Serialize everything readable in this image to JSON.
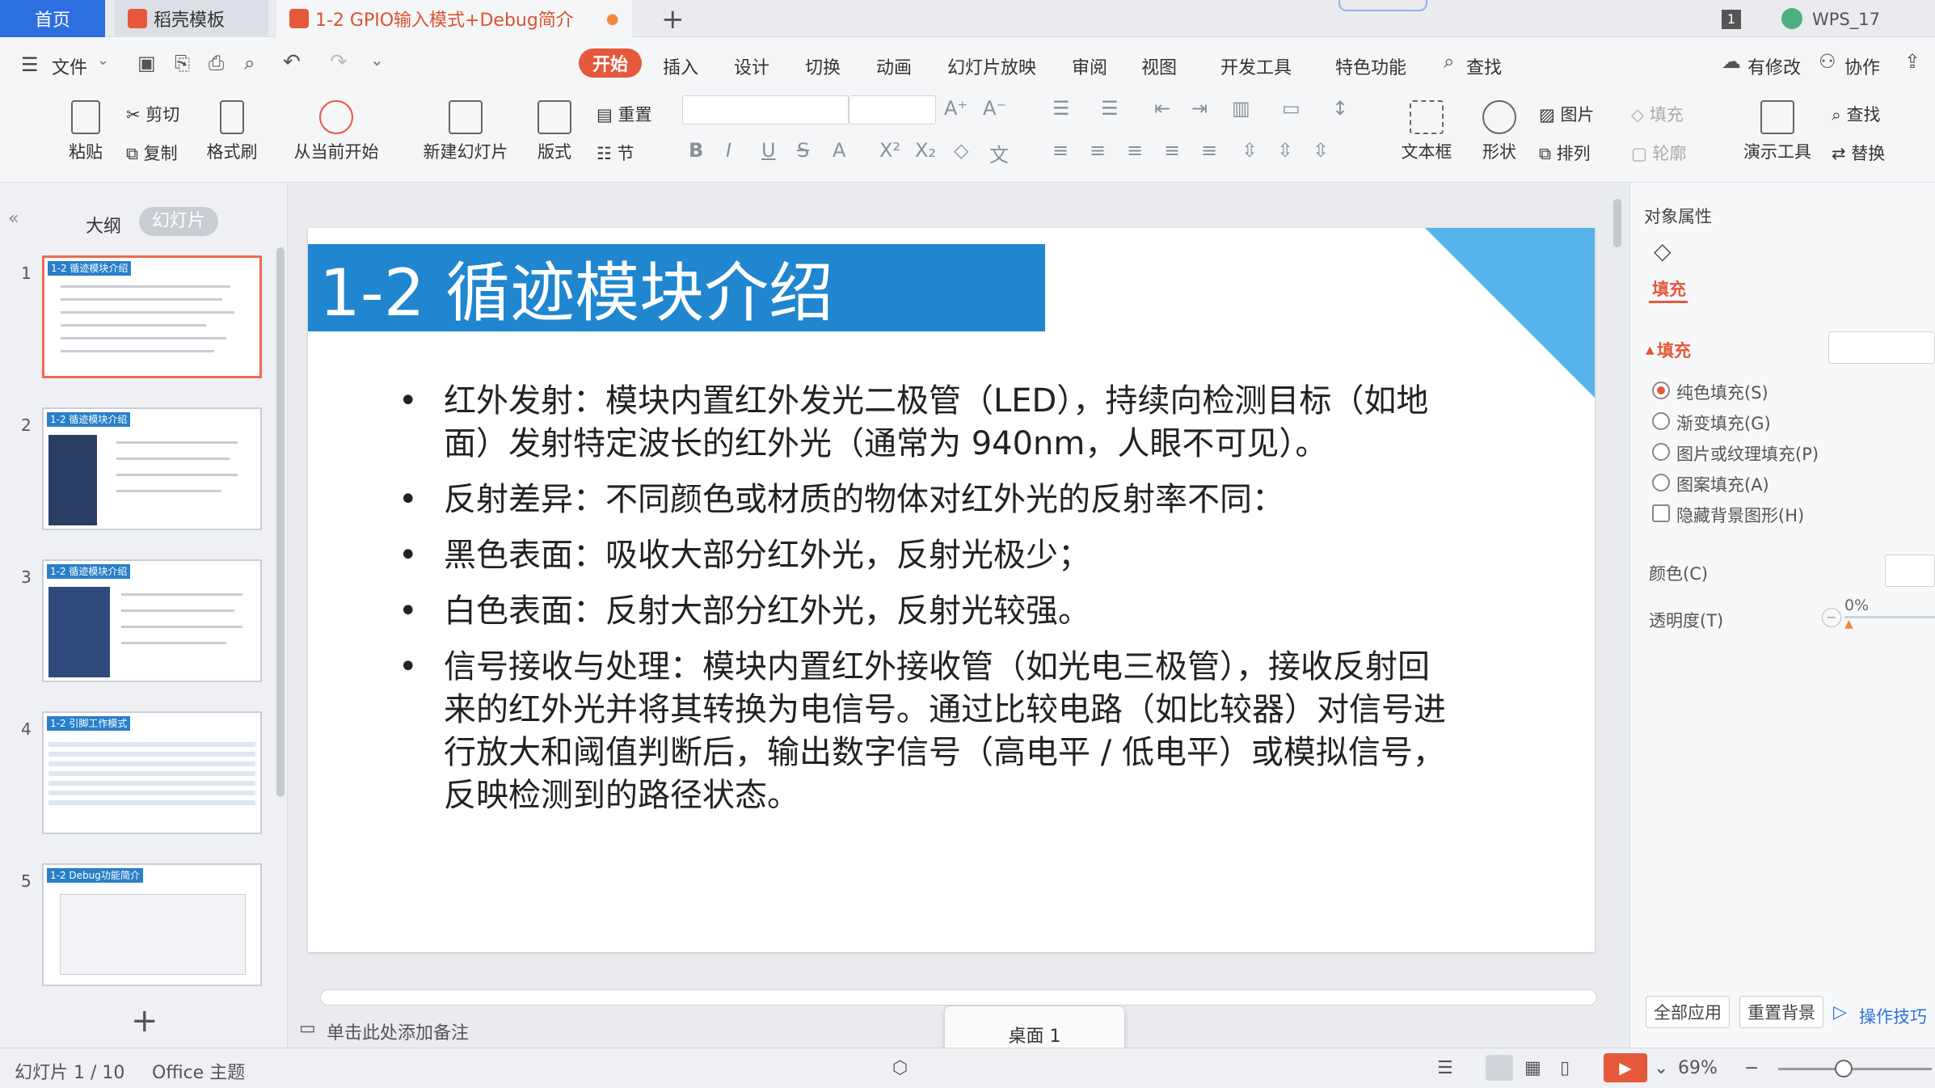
{
  "tabs": {
    "home": "首页",
    "daoke": "稻壳模板",
    "doc": "1-2 GPIO输入模式+Debug简介",
    "user": "WPS_17"
  },
  "menu": {
    "file": "文件",
    "items": [
      "开始",
      "插入",
      "设计",
      "切换",
      "动画",
      "幻灯片放映",
      "审阅",
      "视图",
      "开发工具",
      "特色功能"
    ],
    "search": "查找",
    "modify": "有修改",
    "collab": "协作"
  },
  "ribbon": {
    "paste": "粘贴",
    "cut": "剪切",
    "copy": "复制",
    "format_brush": "格式刷",
    "from_current": "从当前开始",
    "new_slide": "新建幻灯片",
    "layout": "版式",
    "reset": "重置",
    "section": "节",
    "textbox": "文本框",
    "shape": "形状",
    "picture": "图片",
    "arrange": "排列",
    "fill": "填充",
    "outline": "轮廓",
    "presentation_tools": "演示工具",
    "find": "查找",
    "replace": "替换"
  },
  "left_panel": {
    "outline_tab": "大纲",
    "slides_tab": "幻灯片",
    "thumbs": [
      {
        "num": "1",
        "title": "1-2 循迹模块介绍"
      },
      {
        "num": "2",
        "title": "1-2 循迹模块介绍"
      },
      {
        "num": "3",
        "title": "1-2 循迹模块介绍"
      },
      {
        "num": "4",
        "title": "1-2 引脚工作模式"
      },
      {
        "num": "5",
        "title": "1-2 Debug功能简介"
      }
    ]
  },
  "slide": {
    "title": "1-2 循迹模块介绍",
    "bullets": [
      "红外发射：模块内置红外发光二极管（LED），持续向检测目标（如地面）发射特定波长的红外光（通常为 940nm，人眼不可见）。",
      "反射差异：不同颜色或材质的物体对红外光的反射率不同：",
      "黑色表面：吸收大部分红外光，反射光极少；",
      "白色表面：反射大部分红外光，反射光较强。",
      "信号接收与处理：模块内置红外接收管（如光电三极管），接收反射回来的红外光并将其转换为电信号。通过比较电路（如比较器）对信号进行放大和阈值判断后，输出数字信号（高电平 / 低电平）或模拟信号，反映检测到的路径状态。"
    ]
  },
  "notes_placeholder": "单击此处添加备注",
  "desktop_popup": "桌面 1",
  "right_panel": {
    "title": "对象属性",
    "fill_tab": "填充",
    "fill_section": "填充",
    "options": [
      "纯色填充(S)",
      "渐变填充(G)",
      "图片或纹理填充(P)",
      "图案填充(A)"
    ],
    "hide_bg": "隐藏背景图形(H)",
    "color_label": "颜色(C)",
    "transparency_label": "透明度(T)",
    "transparency_value": "0%",
    "apply_all": "全部应用",
    "reset_bg": "重置背景",
    "tips": "操作技巧"
  },
  "status": {
    "slide_info": "幻灯片 1 / 10",
    "theme": "Office 主题",
    "zoom": "69%"
  },
  "colors": {
    "accent": "#e5583b",
    "title_bar": "#1f86cf",
    "corner": "#56b4ea"
  }
}
